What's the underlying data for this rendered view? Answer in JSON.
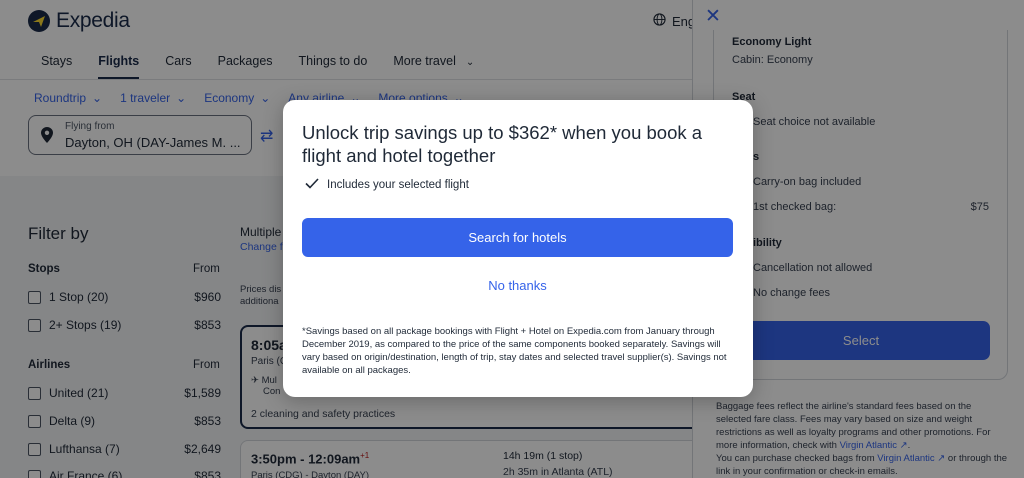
{
  "brand": {
    "name": "Expedia"
  },
  "header": {
    "language_label": "Eng",
    "nav": [
      {
        "label": "Stays"
      },
      {
        "label": "Flights"
      },
      {
        "label": "Cars"
      },
      {
        "label": "Packages"
      },
      {
        "label": "Things to do"
      },
      {
        "label": "More travel"
      }
    ]
  },
  "search": {
    "trip_type": "Roundtrip",
    "travelers": "1 traveler",
    "cabin": "Economy",
    "airline": "Any airline",
    "more_options": "More options",
    "from_label": "Flying from",
    "from_value": "Dayton, OH (DAY-James M. ..."
  },
  "filters": {
    "title": "Filter by",
    "stops_heading": "Stops",
    "from_heading": "From",
    "stops": [
      {
        "label": "1 Stop (20)",
        "price": "$960"
      },
      {
        "label": "2+ Stops (19)",
        "price": "$853"
      }
    ],
    "airlines_heading": "Airlines",
    "airlines_from": "From",
    "airlines": [
      {
        "label": "United (21)",
        "price": "$1,589"
      },
      {
        "label": "Delta (9)",
        "price": "$853"
      },
      {
        "label": "Lufthansa (7)",
        "price": "$2,649"
      },
      {
        "label": "Air France (6)",
        "price": "$853"
      }
    ]
  },
  "results": {
    "multiple": "Multiple",
    "change": "Change f",
    "prices_note_1": "Prices dis",
    "prices_note_2": "additiona",
    "card1": {
      "time": "8:05a",
      "route": "Paris (C",
      "multi_1": "Mul",
      "multi_2": "Con",
      "cleaning": "2 cleaning and safety practices"
    },
    "card2": {
      "time": "3:50pm - 12:09am",
      "day_offset": "+1",
      "route": "Paris (CDG) - Dayton (DAY)",
      "duration": "14h 19m (1 stop)",
      "stop": "2h 35m in Atlanta (ATL)"
    }
  },
  "details_panel": {
    "fare_name": "Economy Light",
    "cabin": "Cabin: Economy",
    "seat_heading": "Seat",
    "seat_text": "Seat choice not available",
    "bags_heading": "s",
    "carry_on": "Carry-on bag included",
    "checked_bag": "1st checked bag:",
    "checked_bag_fee": "$75",
    "flex_heading": "ibility",
    "cancellation": "Cancellation not allowed",
    "change": "No change fees",
    "select_label": "Select",
    "footer_1": "Baggage fees reflect the airline's standard fees based on the selected fare class. Fees may vary based on size and weight restrictions as well as loyalty programs and other promotions. For more information, check with",
    "footer_link_1": "Virgin Atlantic",
    "footer_2": "You can purchase checked bags from",
    "footer_link_2": "Virgin Atlantic",
    "footer_3": "or through the link in your confirmation or check-in emails."
  },
  "modal": {
    "title": "Unlock trip savings up to $362* when you book a flight and hotel together",
    "includes": "Includes your selected flight",
    "primary_button": "Search for hotels",
    "secondary_link": "No thanks",
    "footnote": "*Savings based on all package bookings with Flight + Hotel on Expedia.com from January through December 2019, as compared to the price of the same components booked separately. Savings will vary based on origin/destination, length of trip, stay dates and selected travel supplier(s). Savings not available on all packages."
  },
  "colors": {
    "accent": "#3563e9",
    "brand_navy": "#1a2b49",
    "overlay": "rgba(0,0,0,0.45)"
  }
}
